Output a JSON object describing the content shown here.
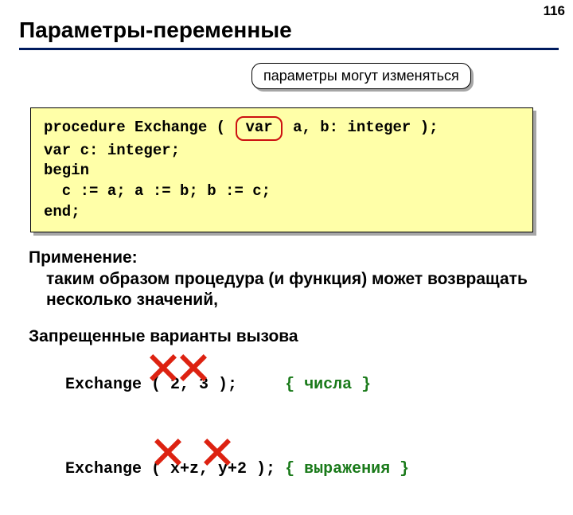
{
  "page_number": "116",
  "title": "Параметры-переменные",
  "callout": "параметры могут изменяться",
  "code": {
    "l1a": "procedure Exchange ( ",
    "var_chip": "var",
    "l1b": " a, b: integer );",
    "l2": "var c: integer;",
    "l3": "begin",
    "l4": "  c := a; a := b; b := c;",
    "l5": "end;"
  },
  "usage": {
    "heading": "Применение:",
    "body": "таким образом процедура (и функция) может возвращать несколько значений,"
  },
  "forbidden": {
    "heading": "Запрещенные варианты вызова",
    "line1_call": "Exchange ( 2, 3 );     ",
    "line1_comment": "{ числа }",
    "line2_call": "Exchange ( x+z, y+2 ); ",
    "line2_comment": "{ выражения }"
  }
}
